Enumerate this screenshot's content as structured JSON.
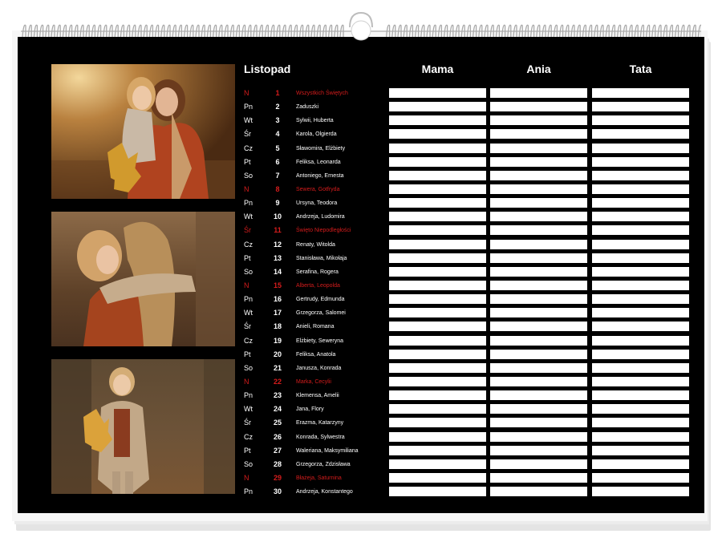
{
  "calendar": {
    "month": "Listopad",
    "columns": [
      "Mama",
      "Ania",
      "Tata"
    ],
    "days": [
      {
        "weekday": "N",
        "day": "1",
        "names": "Wszystkich Świętych",
        "holiday": true
      },
      {
        "weekday": "Pn",
        "day": "2",
        "names": "Zaduszki",
        "holiday": false
      },
      {
        "weekday": "Wt",
        "day": "3",
        "names": "Sylwii, Huberta",
        "holiday": false
      },
      {
        "weekday": "Śr",
        "day": "4",
        "names": "Karola, Olgierda",
        "holiday": false
      },
      {
        "weekday": "Cz",
        "day": "5",
        "names": "Sławomira, Elżbiety",
        "holiday": false
      },
      {
        "weekday": "Pt",
        "day": "6",
        "names": "Feliksa, Leonarda",
        "holiday": false
      },
      {
        "weekday": "So",
        "day": "7",
        "names": "Antoniego, Ernesta",
        "holiday": false
      },
      {
        "weekday": "N",
        "day": "8",
        "names": "Sewera, Gotfryda",
        "holiday": true
      },
      {
        "weekday": "Pn",
        "day": "9",
        "names": "Ursyna, Teodora",
        "holiday": false
      },
      {
        "weekday": "Wt",
        "day": "10",
        "names": "Andrzeja, Ludomira",
        "holiday": false
      },
      {
        "weekday": "Śr",
        "day": "11",
        "names": "Święto Niepodległości",
        "holiday": true
      },
      {
        "weekday": "Cz",
        "day": "12",
        "names": "Renaty, Witolda",
        "holiday": false
      },
      {
        "weekday": "Pt",
        "day": "13",
        "names": "Stanisława, Mikołaja",
        "holiday": false
      },
      {
        "weekday": "So",
        "day": "14",
        "names": "Serafina, Rogera",
        "holiday": false
      },
      {
        "weekday": "N",
        "day": "15",
        "names": "Alberta, Leopolda",
        "holiday": true
      },
      {
        "weekday": "Pn",
        "day": "16",
        "names": "Gertrudy, Edmunda",
        "holiday": false
      },
      {
        "weekday": "Wt",
        "day": "17",
        "names": "Grzegorza, Salomei",
        "holiday": false
      },
      {
        "weekday": "Śr",
        "day": "18",
        "names": "Anieli, Romana",
        "holiday": false
      },
      {
        "weekday": "Cz",
        "day": "19",
        "names": "Elżbiety, Seweryna",
        "holiday": false
      },
      {
        "weekday": "Pt",
        "day": "20",
        "names": "Feliksa, Anatola",
        "holiday": false
      },
      {
        "weekday": "So",
        "day": "21",
        "names": "Janusza, Konrada",
        "holiday": false
      },
      {
        "weekday": "N",
        "day": "22",
        "names": "Marka, Cecylii",
        "holiday": true
      },
      {
        "weekday": "Pn",
        "day": "23",
        "names": "Klemensa, Amelii",
        "holiday": false
      },
      {
        "weekday": "Wt",
        "day": "24",
        "names": "Jana, Flory",
        "holiday": false
      },
      {
        "weekday": "Śr",
        "day": "25",
        "names": "Erazma, Katarzyny",
        "holiday": false
      },
      {
        "weekday": "Cz",
        "day": "26",
        "names": "Konrada, Sylwestra",
        "holiday": false
      },
      {
        "weekday": "Pt",
        "day": "27",
        "names": "Waleriana, Maksymiliana",
        "holiday": false
      },
      {
        "weekday": "So",
        "day": "28",
        "names": "Grzegorza, Zdzisława",
        "holiday": false
      },
      {
        "weekday": "N",
        "day": "29",
        "names": "Błażeja, Saturnina",
        "holiday": true
      },
      {
        "weekday": "Pn",
        "day": "30",
        "names": "Andrzeja, Konstantego",
        "holiday": false
      }
    ]
  },
  "colors": {
    "background": "#000000",
    "text": "#ffffff",
    "holiday": "#d41c1c",
    "cell": "#ffffff"
  }
}
